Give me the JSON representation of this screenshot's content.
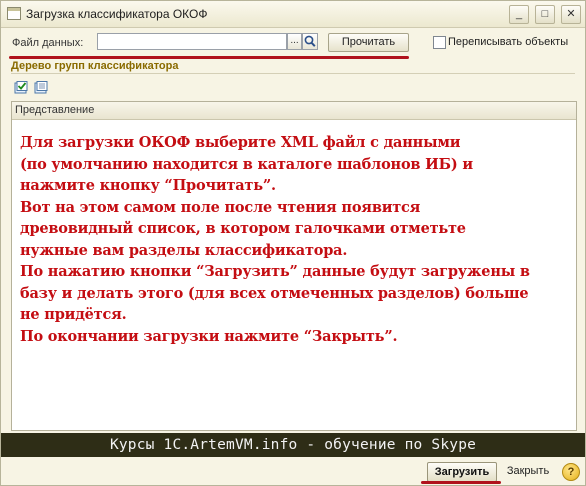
{
  "window": {
    "title": "Загрузка классификатора ОКОФ",
    "minimize_glyph": "_",
    "maximize_glyph": "□",
    "close_glyph": "✕"
  },
  "form": {
    "file_label": "Файл данных:",
    "file_value": "",
    "select_glyph": "...",
    "read_button": "Прочитать",
    "overwrite_label": "Переписывать объекты",
    "overwrite_checked": false
  },
  "group": {
    "title": "Дерево групп классификатора"
  },
  "tree": {
    "column_header": "Представление",
    "note_lines": [
      "Для загрузки ОКОФ выберите XML файл с данными",
      "(по умолчанию находится в каталоге шаблонов ИБ) и",
      "нажмите кнопку “Прочитать”.",
      "Вот на этом самом поле после чтения появится",
      "древовидный список, в котором галочками отметьте",
      "нужные вам разделы классификатора.",
      "По нажатию кнопки “Загрузить” данные будут загружены в",
      "базу и делать этого (для всех отмеченных разделов) больше",
      "не придётся.",
      "По окончании загрузки нажмите “Закрыть”."
    ]
  },
  "banner": {
    "text": "Курсы 1С.ArtemVM.info - обучение по Skype"
  },
  "footer": {
    "load_button": "Загрузить",
    "close_button": "Закрыть",
    "help_glyph": "?"
  },
  "colors": {
    "annotation_red": "#c40d12",
    "underline_red": "#b0121c",
    "group_title": "#8a6b00",
    "banner_bg": "#2e2d16"
  }
}
